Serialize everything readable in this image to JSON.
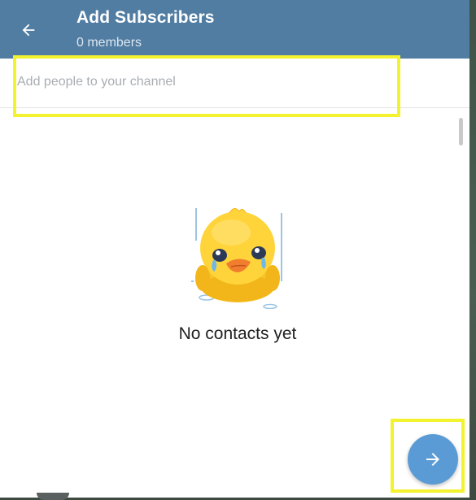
{
  "header": {
    "title": "Add Subscribers",
    "subtitle": "0 members",
    "back_icon": "arrow-left-icon",
    "color": "#517da2"
  },
  "search": {
    "placeholder": "Add people to your channel",
    "value": ""
  },
  "empty_state": {
    "illustration": "crying-duck-sticker",
    "message": "No contacts yet"
  },
  "fab": {
    "icon": "arrow-right-icon",
    "color": "#5b9bd5"
  },
  "highlights": {
    "color": "#f2f22e"
  }
}
